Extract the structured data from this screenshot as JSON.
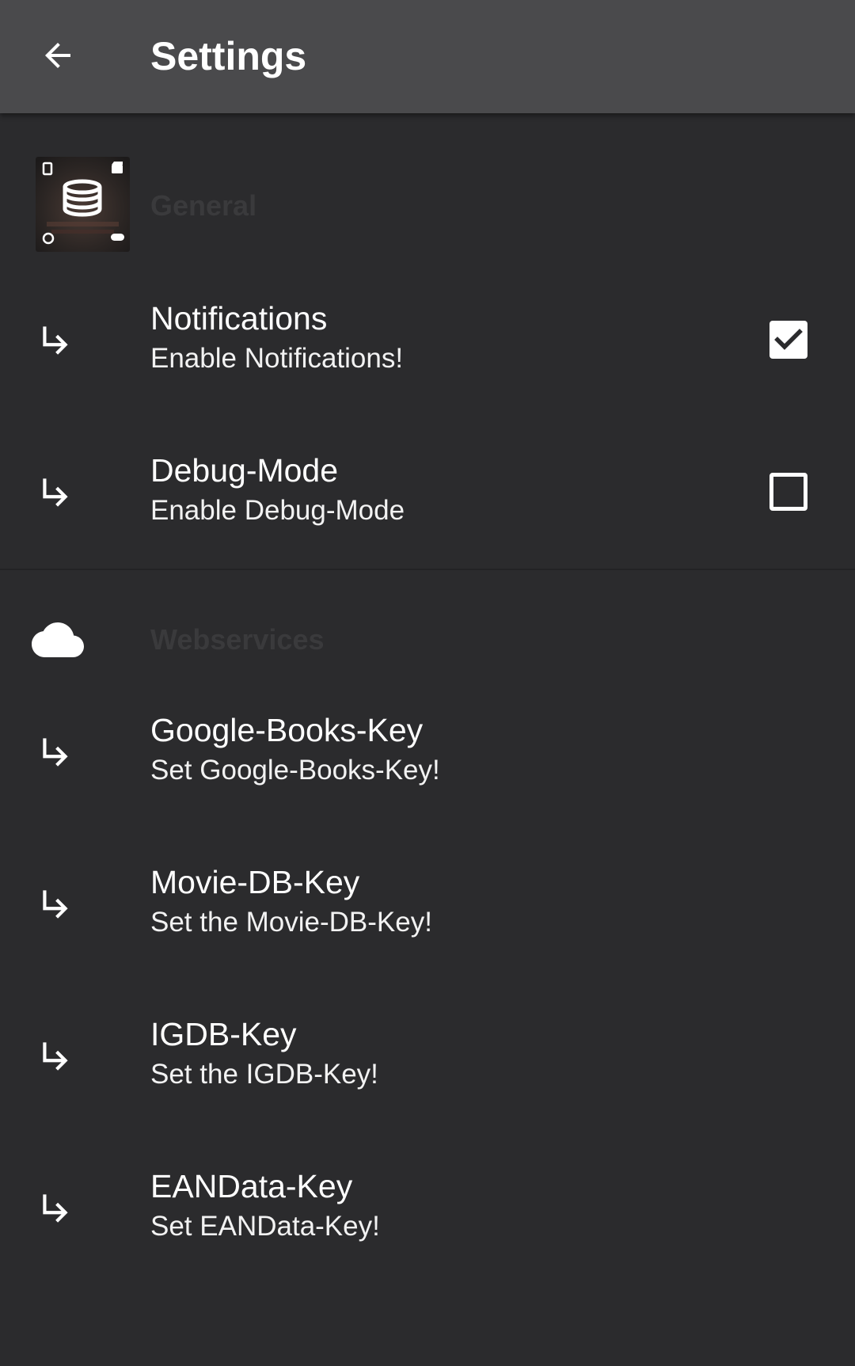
{
  "toolbar": {
    "title": "Settings",
    "back_icon": "arrow-left-icon"
  },
  "categories": [
    {
      "title": "General",
      "icon": "media-database-app-icon",
      "preferences": [
        {
          "title": "Notifications",
          "summary": "Enable Notifications!",
          "icon": "subdirectory-arrow-right-icon",
          "checkbox": true,
          "checked": true
        },
        {
          "title": "Debug-Mode",
          "summary": "Enable Debug-Mode",
          "icon": "subdirectory-arrow-right-icon",
          "checkbox": true,
          "checked": false
        }
      ]
    },
    {
      "title": "Webservices",
      "icon": "cloud-icon",
      "preferences": [
        {
          "title": "Google-Books-Key",
          "summary": "Set Google-Books-Key!",
          "icon": "subdirectory-arrow-right-icon"
        },
        {
          "title": "Movie-DB-Key",
          "summary": "Set the Movie-DB-Key!",
          "icon": "subdirectory-arrow-right-icon"
        },
        {
          "title": "IGDB-Key",
          "summary": "Set the IGDB-Key!",
          "icon": "subdirectory-arrow-right-icon"
        },
        {
          "title": "EANData-Key",
          "summary": "Set EANData-Key!",
          "icon": "subdirectory-arrow-right-icon"
        }
      ]
    }
  ],
  "colors": {
    "toolbar_bg": "#4a4a4c",
    "page_bg": "#2b2b2d",
    "category_title": "#3a3a3c",
    "text": "#ffffff"
  }
}
